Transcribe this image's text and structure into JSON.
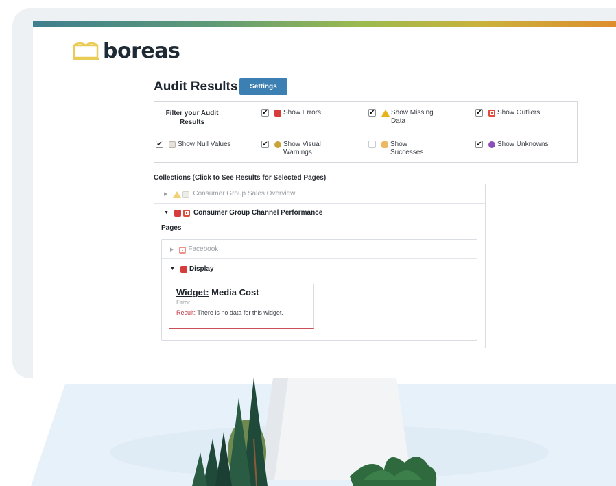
{
  "brand": {
    "name": "boreas"
  },
  "audit": {
    "title": "Audit Results",
    "settings_label": "Settings"
  },
  "filter": {
    "heading": "Filter your Audit Results",
    "options": [
      {
        "label": "Show Errors",
        "checked": true,
        "icon": "error-icon"
      },
      {
        "label": "Show Missing Data",
        "checked": true,
        "icon": "warning-icon"
      },
      {
        "label": "Show Outliers",
        "checked": true,
        "icon": "outlier-icon"
      },
      {
        "label": "Show Null Values",
        "checked": true,
        "icon": "null-value-icon"
      },
      {
        "label": "Show Visual Warnings",
        "checked": true,
        "icon": "visual-warning-icon"
      },
      {
        "label": "Show Successes",
        "checked": false,
        "icon": "success-icon"
      },
      {
        "label": "Show Unknowns",
        "checked": true,
        "icon": "unknown-icon"
      }
    ]
  },
  "collections": {
    "label": "Collections (Click to See Results for Selected Pages)",
    "items": [
      {
        "name": "Consumer Group Sales Overview",
        "expanded": false
      },
      {
        "name": "Consumer Group Channel Performance",
        "expanded": true
      }
    ]
  },
  "pages": {
    "label": "Pages",
    "items": [
      {
        "name": "Facebook",
        "expanded": false
      },
      {
        "name": "Display",
        "expanded": true
      }
    ]
  },
  "widget": {
    "prefix": "Widget:",
    "name": "Media Cost",
    "status": "Error",
    "result_label": "Result:",
    "result_text": "There is no data for this widget."
  },
  "colors": {
    "accent": "#3c7fb2",
    "error": "#d63c3c",
    "warning": "#e8b21a",
    "text": "#1e2329"
  }
}
